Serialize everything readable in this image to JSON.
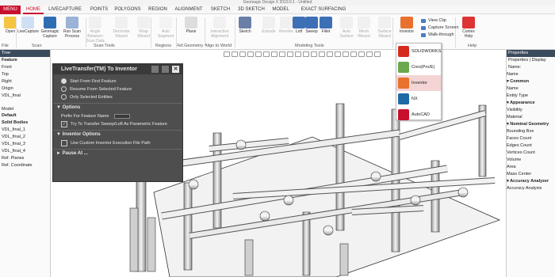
{
  "window": {
    "title": "Geomagic Design X 2019.0.1 - Untitled"
  },
  "tabs": [
    "MENU",
    "HOME",
    "LIVECAPTURE",
    "POINTS",
    "POLYGONS",
    "REGION",
    "ALIGNMENT",
    "SKETCH",
    "3D SKETCH",
    "MODEL",
    "EXACT SURFACING"
  ],
  "active_tab": "HOME",
  "ribbon": {
    "buttons": [
      {
        "label": "Open"
      },
      {
        "label": "LiveCapture"
      },
      {
        "label": "Geomagic Capture"
      },
      {
        "label": "Run Scan Process"
      },
      {
        "label": "Angle Between Scan Data"
      },
      {
        "label": "Decimate Wizard"
      },
      {
        "label": "Wrap Wizard"
      },
      {
        "label": "Auto Segment"
      },
      {
        "label": "Plane"
      },
      {
        "label": "Interactive Alignment"
      },
      {
        "label": "Sketch"
      },
      {
        "label": "Extrude"
      },
      {
        "label": "Revolve"
      },
      {
        "label": "Loft"
      },
      {
        "label": "Sweep"
      },
      {
        "label": "Fillet"
      },
      {
        "label": "Auto Surface"
      },
      {
        "label": "Mesh Wizard"
      },
      {
        "label": "Surface Wizard"
      },
      {
        "label": "Inventor"
      },
      {
        "label": "Contex Help"
      }
    ],
    "small_buttons": [
      "View Clip",
      "Capture Screen",
      "Walk-through"
    ],
    "groups": [
      "File",
      "Scan",
      "Scan Tools",
      "Regions",
      "Ref.Geometry",
      "Align to World",
      "Modeling Tools",
      "Help"
    ]
  },
  "left_panel": {
    "header": "Tree",
    "items": [
      "Feature",
      "Front",
      "Top",
      "Right",
      "Origin",
      "VDL_final"
    ],
    "lower_title": "Model",
    "lower_items": [
      "Default",
      "Solid Bodies",
      "VDL_final_1",
      "VDL_final_2",
      "VDL_final_3",
      "VDL_final_4",
      "Ref. Planes",
      "Ref. Coordinate"
    ]
  },
  "livetransfer": {
    "title": "LiveTransfer(TM) To Inventor",
    "transfer_options": [
      "Start From First Feature",
      "Resume From Selected Feature",
      "Only Selected Entities"
    ],
    "options_header": "Options",
    "prefix_label": "Prefix For Feature Name",
    "sweep_label": "Try To Transfer Sweep/Loft As Parametric Feature",
    "inventor_header": "Inventor Options",
    "custom_path_label": "Use Custom Inventor Execution File Path",
    "pause_label": "Pause At ..."
  },
  "dropdown": {
    "items": [
      {
        "label": "SOLIDWORKS",
        "color": "#d52b1e"
      },
      {
        "label": "Creo(Pro/E)",
        "color": "#6aa84f"
      },
      {
        "label": "Inventor",
        "color": "#e8712d"
      },
      {
        "label": "NX",
        "color": "#1f6aa5"
      },
      {
        "label": "AutoCAD",
        "color": "#c8102e"
      }
    ],
    "selected": "Inventor"
  },
  "properties": {
    "header": "Properties",
    "tab1": "Properties",
    "tab2": "Display",
    "name_label": "Name:",
    "items": [
      {
        "label": "Name",
        "bold": false
      },
      {
        "label": "Common",
        "bold": true
      },
      {
        "label": "Name",
        "bold": false
      },
      {
        "label": "Entity Type",
        "bold": false
      },
      {
        "label": "Appearance",
        "bold": true
      },
      {
        "label": "Visibility",
        "bold": false
      },
      {
        "label": "Material",
        "bold": false
      },
      {
        "label": "Nominal Geometry",
        "bold": true
      },
      {
        "label": "Bounding Box",
        "bold": false
      },
      {
        "label": "Faces Count",
        "bold": false
      },
      {
        "label": "Edges Count",
        "bold": false
      },
      {
        "label": "Vertices Count",
        "bold": false
      },
      {
        "label": "Volume",
        "bold": false
      },
      {
        "label": "Area",
        "bold": false
      },
      {
        "label": "Mass Center",
        "bold": false
      },
      {
        "label": "Accuracy Analyzer",
        "bold": true
      },
      {
        "label": "Accuracy Analysis",
        "bold": false
      }
    ]
  },
  "colors": {
    "accent": "#c8102e",
    "panel": "#4e4e4e",
    "header": "#3b4b5e"
  }
}
